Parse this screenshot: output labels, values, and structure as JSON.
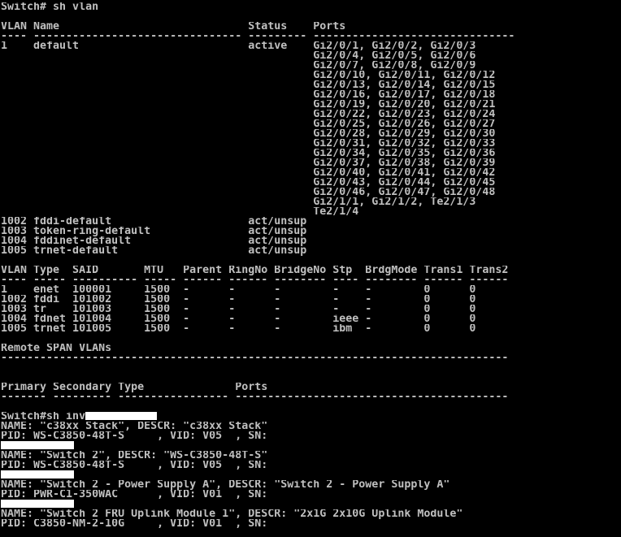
{
  "terminal": {
    "lines": [
      "Switch# sh vlan",
      "",
      "VLAN Name                             Status    Ports",
      "---- -------------------------------- --------- -------------------------------",
      "1    default                          active    Gi2/0/1, Gi2/0/2, Gi2/0/3",
      "                                                Gi2/0/4, Gi2/0/5, Gi2/0/6",
      "                                                Gi2/0/7, Gi2/0/8, Gi2/0/9",
      "                                                Gi2/0/10, Gi2/0/11, Gi2/0/12",
      "                                                Gi2/0/13, Gi2/0/14, Gi2/0/15",
      "                                                Gi2/0/16, Gi2/0/17, Gi2/0/18",
      "                                                Gi2/0/19, Gi2/0/20, Gi2/0/21",
      "                                                Gi2/0/22, Gi2/0/23, Gi2/0/24",
      "                                                Gi2/0/25, Gi2/0/26, Gi2/0/27",
      "                                                Gi2/0/28, Gi2/0/29, Gi2/0/30",
      "                                                Gi2/0/31, Gi2/0/32, Gi2/0/33",
      "                                                Gi2/0/34, Gi2/0/35, Gi2/0/36",
      "                                                Gi2/0/37, Gi2/0/38, Gi2/0/39",
      "                                                Gi2/0/40, Gi2/0/41, Gi2/0/42",
      "                                                Gi2/0/43, Gi2/0/44, Gi2/0/45",
      "                                                Gi2/0/46, Gi2/0/47, Gi2/0/48",
      "                                                Gi2/1/1, Gi2/1/2, Te2/1/3",
      "                                                Te2/1/4",
      "1002 fddi-default                     act/unsup",
      "1003 token-ring-default               act/unsup",
      "1004 fddinet-default                  act/unsup",
      "1005 trnet-default                    act/unsup",
      "",
      "VLAN Type  SAID       MTU   Parent RingNo BridgeNo Stp  BrdgMode Trans1 Trans2",
      "---- ----- ---------- ----- ------ ------ -------- ---- -------- ------ ------",
      "1    enet  100001     1500  -      -      -        -    -        0      0",
      "1002 fddi  101002     1500  -      -      -        -    -        0      0",
      "1003 tr    101003     1500  -      -      -        -    -        0      0",
      "1004 fdnet 101004     1500  -      -      -        ieee -        0      0",
      "1005 trnet 101005     1500  -      -      -        ibm  -        0      0",
      "",
      "Remote SPAN VLANs",
      "------------------------------------------------------------------------------",
      "",
      "",
      "Primary Secondary Type              Ports",
      "------- --------- ----------------- ------------------------------------------",
      "",
      "Switch#sh inv",
      "NAME: \"c38xx Stack\", DESCR: \"c38xx Stack\"",
      "PID: WS-C3850-48T-S     , VID: V05  , SN: ",
      "",
      "NAME: \"Switch 2\", DESCR: \"WS-C3850-48T-S\"",
      "PID: WS-C3850-48T-S     , VID: V05  , SN: ",
      "",
      "NAME: \"Switch 2 - Power Supply A\", DESCR: \"Switch 2 - Power Supply A\"",
      "PID: PWR-C1-350WAC      , VID: V01  , SN: ",
      "",
      "NAME: \"Switch 2 FRU Uplink Module 1\", DESCR: \"2x1G 2x10G Uplink Module\"",
      "PID: C3850-NM-2-10G     , VID: V01  , SN: "
    ],
    "redacted_serial_lines": [
      42,
      45,
      48,
      51
    ]
  }
}
